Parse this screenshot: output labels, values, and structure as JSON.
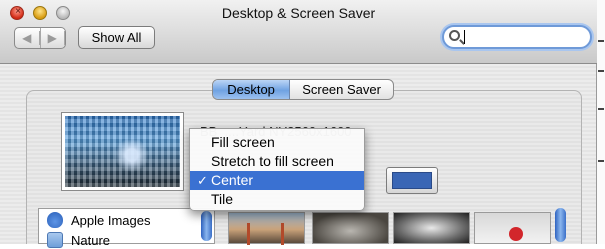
{
  "window": {
    "title": "Desktop & Screen Saver"
  },
  "toolbar": {
    "back_glyph": "◀",
    "forward_glyph": "▶",
    "show_all_label": "Show All",
    "search_value": ""
  },
  "tabs": [
    {
      "label": "Desktop",
      "selected": true
    },
    {
      "label": "Screen Saver",
      "selected": false
    }
  ],
  "current_picture": {
    "filename": "BB_....Yard NY2560x1600"
  },
  "position_menu": {
    "items": [
      {
        "label": "Fill screen",
        "checked": false
      },
      {
        "label": "Stretch to fill screen",
        "checked": false
      },
      {
        "label": "Center",
        "checked": true
      },
      {
        "label": "Tile",
        "checked": false
      }
    ],
    "check_glyph": "✓"
  },
  "background_color": "#3a66b5",
  "source_list": {
    "items": [
      {
        "label": "Apple Images",
        "icon": "apple-icon"
      },
      {
        "label": "Nature",
        "icon": "folder-icon"
      }
    ]
  },
  "colors": {
    "accent": "#3a71d2",
    "tab_selected": "#6fa2e2"
  }
}
